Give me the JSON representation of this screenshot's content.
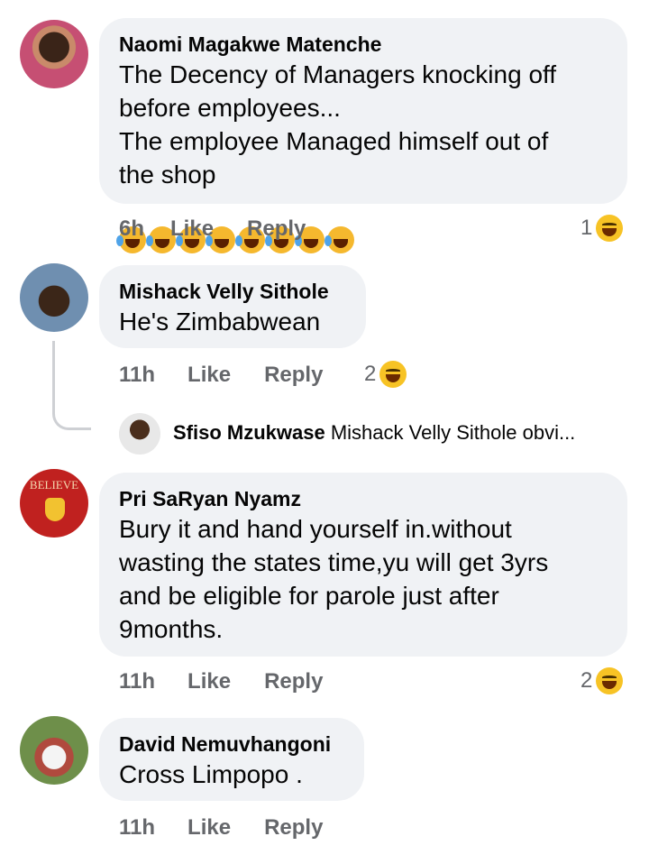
{
  "comments": [
    {
      "author": "Naomi Magakwe Matenche",
      "text": "The Decency of Managers knocking off\nbefore  employees...\nThe employee Managed himself out of\nthe shop",
      "emoji_count": 8,
      "time": "6h",
      "like_label": "Like",
      "reply_label": "Reply",
      "reaction_count": "1"
    },
    {
      "author": "Mishack Velly Sithole",
      "text": "He's Zimbabwean",
      "time": "11h",
      "like_label": "Like",
      "reply_label": "Reply",
      "reaction_count": "2"
    },
    {
      "author": "Pri SaRyan Nyamz",
      "text": "Bury it and hand yourself in.without\nwasting the states time,yu will get 3yrs\nand be eligible for parole just after\n9months.",
      "time": "11h",
      "like_label": "Like",
      "reply_label": "Reply",
      "reaction_count": "2"
    },
    {
      "author": "David Nemuvhangoni",
      "text": "Cross Limpopo .",
      "time": "11h",
      "like_label": "Like",
      "reply_label": "Reply"
    }
  ],
  "reply_preview": {
    "author": "Sfiso Mzukwase",
    "text": "Mishack Velly Sithole obvi..."
  },
  "avatar_3_text": "BELIEVE",
  "colors": {
    "bubble": "#f0f2f5",
    "meta": "#65676b",
    "thread_line": "#ced0d4"
  }
}
